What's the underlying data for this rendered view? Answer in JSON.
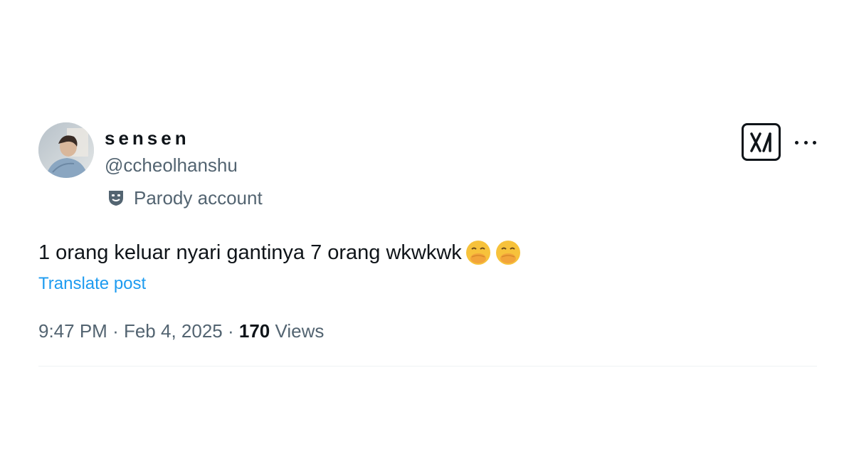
{
  "author": {
    "display_name": "sensen",
    "handle": "@ccheolhanshu",
    "badge_label": "Parody account",
    "badge_icon": "theater-mask-icon",
    "avatar_icon": "profile-photo"
  },
  "post": {
    "text": "1 orang keluar nyari gantinya 7 orang wkwkwk",
    "emojis": [
      "face-with-hand-over-mouth",
      "face-with-hand-over-mouth"
    ],
    "translate_label": "Translate post"
  },
  "meta": {
    "time": "9:47 PM",
    "separator": "·",
    "date": "Feb 4, 2025",
    "views_count": "170",
    "views_label": "Views"
  },
  "header_actions": {
    "logo_icon": "x-logo-icon",
    "more_icon": "more-horizontal-icon"
  },
  "colors": {
    "primary_text": "#0f1419",
    "secondary_text": "#536471",
    "link": "#1d9bf0",
    "divider": "#eff3f4"
  }
}
